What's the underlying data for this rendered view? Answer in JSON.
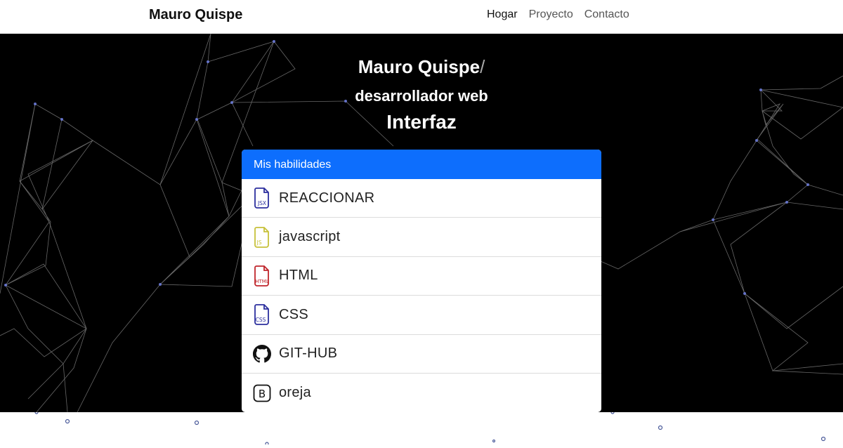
{
  "navbar": {
    "brand": "Mauro Quispe",
    "links": [
      {
        "label": "Hogar",
        "active": true
      },
      {
        "label": "Proyecto",
        "active": false
      },
      {
        "label": "Contacto",
        "active": false
      }
    ]
  },
  "hero": {
    "name": "Mauro Quispe",
    "cursor": "/",
    "role": "desarrollador web",
    "word": "Interfaz"
  },
  "skills": {
    "header": "Mis habilidades",
    "items": [
      {
        "label": "REACCIONAR",
        "icon": "jsx-file-icon",
        "color": "#2c2f9e",
        "tag": "JSX"
      },
      {
        "label": "javascript",
        "icon": "js-file-icon",
        "color": "#c7c13a",
        "tag": "JS"
      },
      {
        "label": "HTML",
        "icon": "html-file-icon",
        "color": "#c0262c",
        "tag": "HTML"
      },
      {
        "label": "CSS",
        "icon": "css-file-icon",
        "color": "#2c2f9e",
        "tag": "CSS"
      },
      {
        "label": "GIT-HUB",
        "icon": "github-icon",
        "color": "#111111",
        "tag": ""
      },
      {
        "label": "oreja",
        "icon": "bootstrap-icon",
        "color": "#111111",
        "tag": "B"
      }
    ]
  },
  "colors": {
    "accent": "#0d6efd",
    "hero_bg": "#000000"
  }
}
